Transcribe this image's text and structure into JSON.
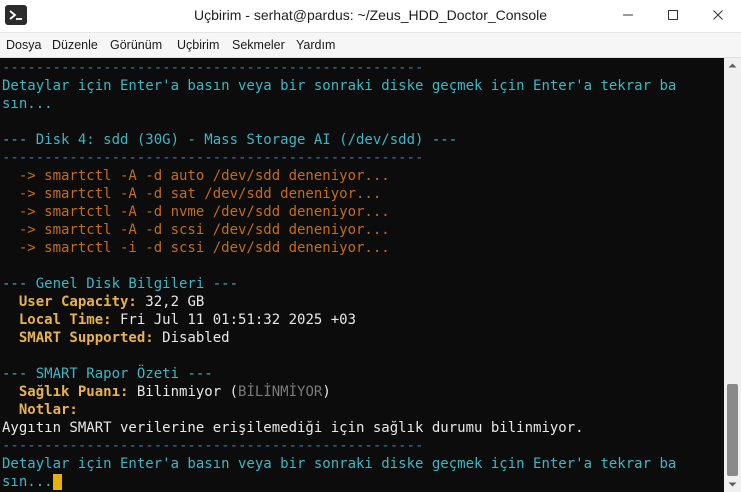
{
  "window": {
    "title": "Uçbirim - serhat@pardus: ~/Zeus_HDD_Doctor_Console",
    "controls": [
      "minimize",
      "maximize",
      "close"
    ]
  },
  "menu": {
    "items": [
      "Dosya",
      "Düzenle",
      "Görünüm",
      "Uçbirim",
      "Sekmeler",
      "Yardım"
    ]
  },
  "terminal": {
    "separator": "--------------------------------------------------",
    "prompt_line1": "Detaylar için Enter'a basın veya bir sonraki diske geçmek için Enter'a tekrar ba",
    "prompt_line2": "sın...",
    "disk_header": "--- Disk 4: sdd (30G) - Mass Storage AI (/dev/sdd) ---",
    "attempts": [
      "  -> smartctl -A -d auto /dev/sdd deneniyor...",
      "  -> smartctl -A -d sat /dev/sdd deneniyor...",
      "  -> smartctl -A -d nvme /dev/sdd deneniyor...",
      "  -> smartctl -A -d scsi /dev/sdd deneniyor...",
      "  -> smartctl -i -d scsi /dev/sdd deneniyor..."
    ],
    "general_header": "--- Genel Disk Bilgileri ---",
    "info": [
      {
        "label": "User Capacity:",
        "value": " 32,2 GB"
      },
      {
        "label": "Local Time:",
        "value": " Fri Jul 11 01:51:32 2025 +03"
      },
      {
        "label": "SMART Supported:",
        "value": " Disabled"
      }
    ],
    "summary_header": "--- SMART Rapor Özeti ---",
    "health_label": "Sağlık Puanı:",
    "health_value": " Bilinmiyor (",
    "health_code": "BİLİNMİYOR",
    "health_close": ")",
    "notes_label": "Notlar:",
    "notes_text": "Aygıtın SMART verilerine erişilemediği için sağlık durumu bilinmiyor."
  },
  "colors": {
    "cyan": "#3bb8c4",
    "orange": "#c46c1a",
    "label": "#e8b34a",
    "cursor": "#e8b000",
    "background": "#0c0c0c"
  }
}
